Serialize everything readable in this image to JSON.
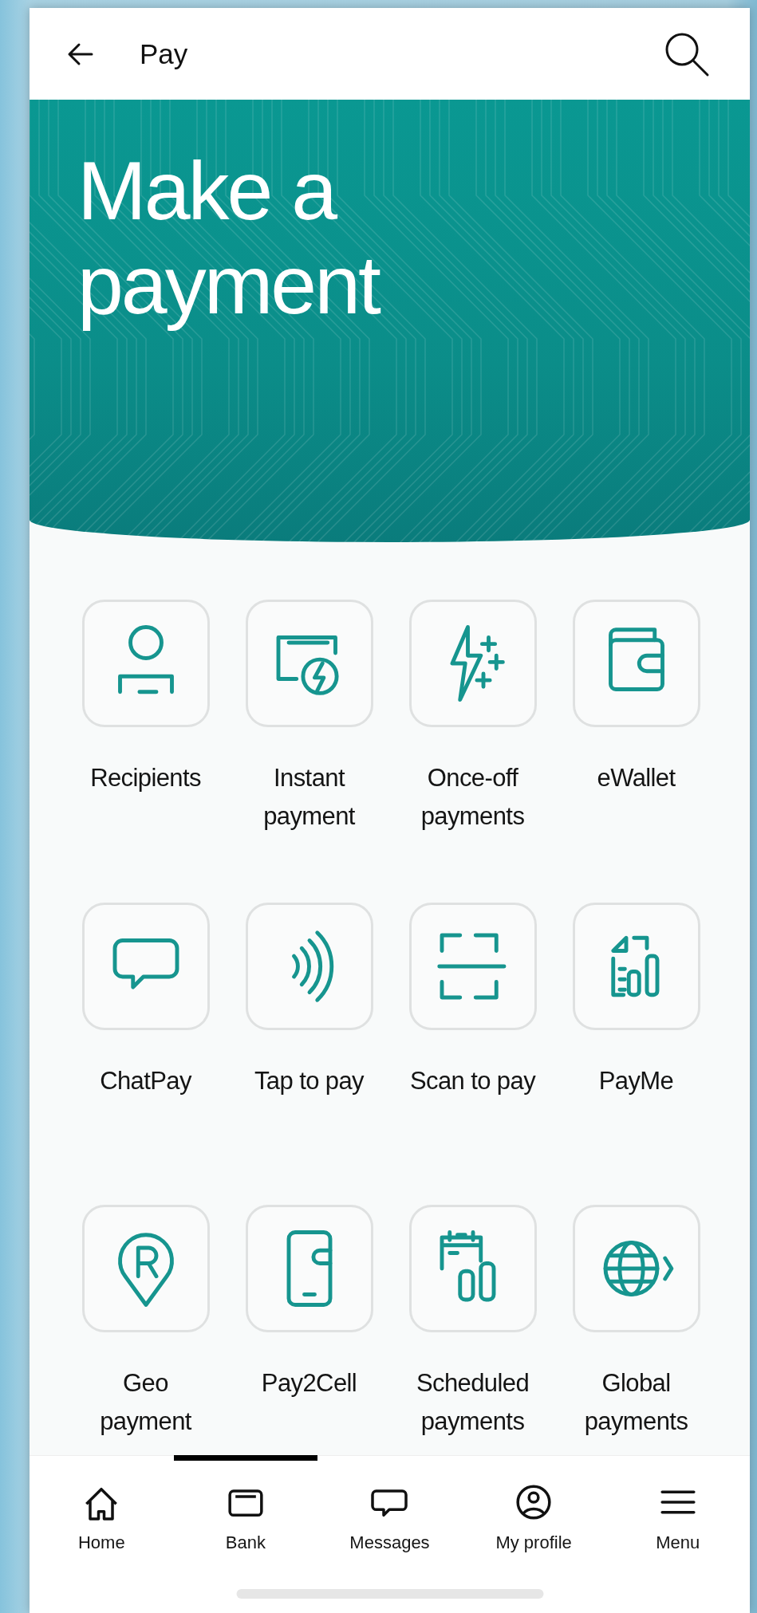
{
  "header": {
    "title": "Pay"
  },
  "banner": {
    "heading": "Make a payment"
  },
  "actions": [
    {
      "label": "Recipients"
    },
    {
      "label": "Instant payment"
    },
    {
      "label": "Once-off payments"
    },
    {
      "label": "eWallet"
    },
    {
      "label": "ChatPay"
    },
    {
      "label": "Tap to pay"
    },
    {
      "label": "Scan to pay"
    },
    {
      "label": "PayMe"
    },
    {
      "label": "Geo payment"
    },
    {
      "label": "Pay2Cell"
    },
    {
      "label": "Scheduled payments"
    },
    {
      "label": "Global payments"
    }
  ],
  "bottom_nav": [
    {
      "label": "Home",
      "selected": false
    },
    {
      "label": "Bank",
      "selected": true
    },
    {
      "label": "Messages",
      "selected": false
    },
    {
      "label": "My profile",
      "selected": false
    },
    {
      "label": "Menu",
      "selected": false
    }
  ]
}
